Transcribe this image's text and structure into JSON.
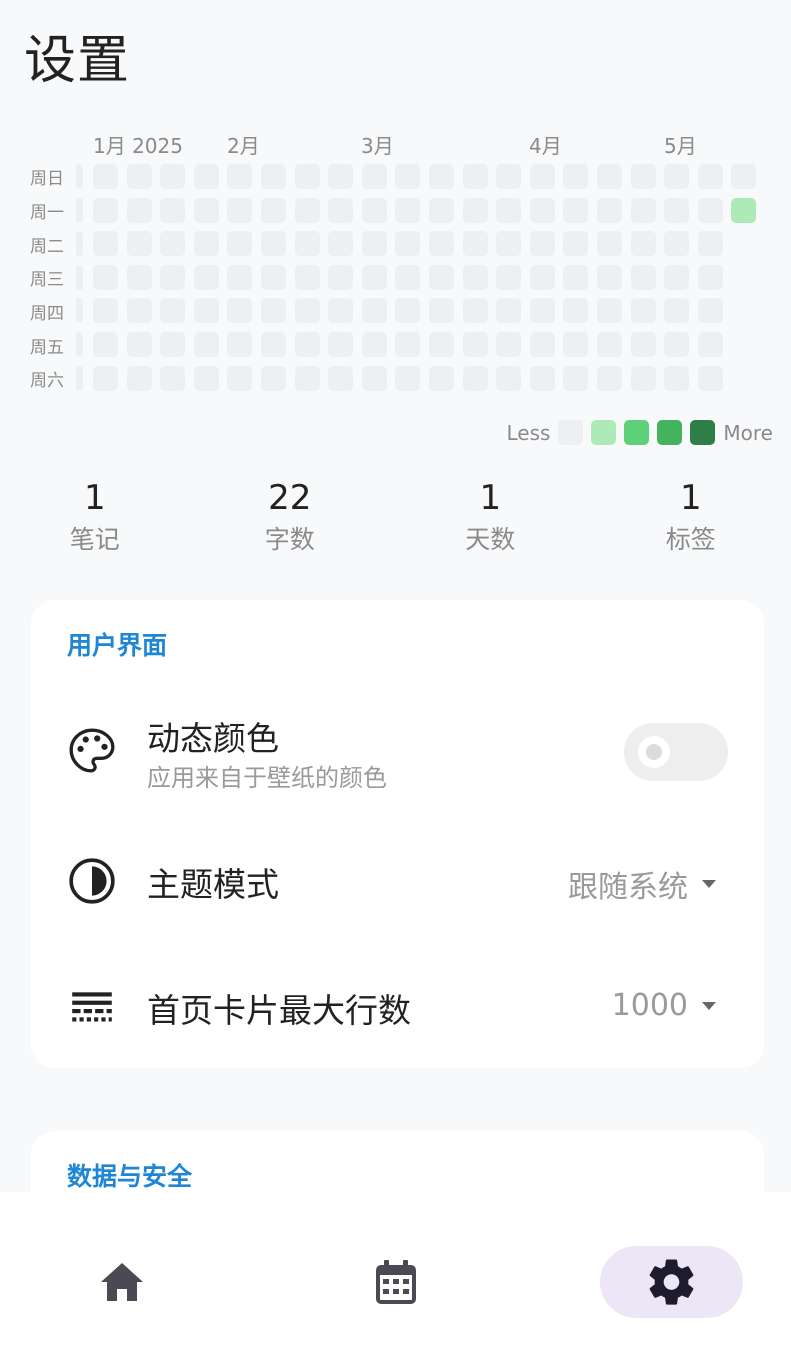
{
  "page": {
    "title": "设置"
  },
  "heatmap": {
    "months": [
      "1月 2025",
      "2月",
      "3月",
      "4月",
      "5月"
    ],
    "days": [
      "周日",
      "周一",
      "周二",
      "周三",
      "周四",
      "周五",
      "周六"
    ],
    "legend": {
      "less": "Less",
      "more": "More"
    },
    "colors": {
      "empty": "#eeeff2",
      "level1": "#aeeab8",
      "level2": "#5fd07a",
      "level3": "#45b35e",
      "level4": "#2f7d47"
    }
  },
  "stats": [
    {
      "value": "1",
      "label": "笔记"
    },
    {
      "value": "22",
      "label": "字数"
    },
    {
      "value": "1",
      "label": "天数"
    },
    {
      "value": "1",
      "label": "标签"
    }
  ],
  "ui_section": {
    "title": "用户界面",
    "dynamic_color": {
      "title": "动态颜色",
      "subtitle": "应用来自于壁纸的颜色",
      "enabled": false
    },
    "theme_mode": {
      "title": "主题模式",
      "value": "跟随系统"
    },
    "max_lines": {
      "title": "首页卡片最大行数",
      "value": "1000"
    }
  },
  "data_section": {
    "title": "数据与安全"
  },
  "nav": {
    "active": "settings",
    "items": [
      "home-icon",
      "calendar-icon",
      "gear-icon"
    ]
  },
  "accent": "#1f86d6"
}
